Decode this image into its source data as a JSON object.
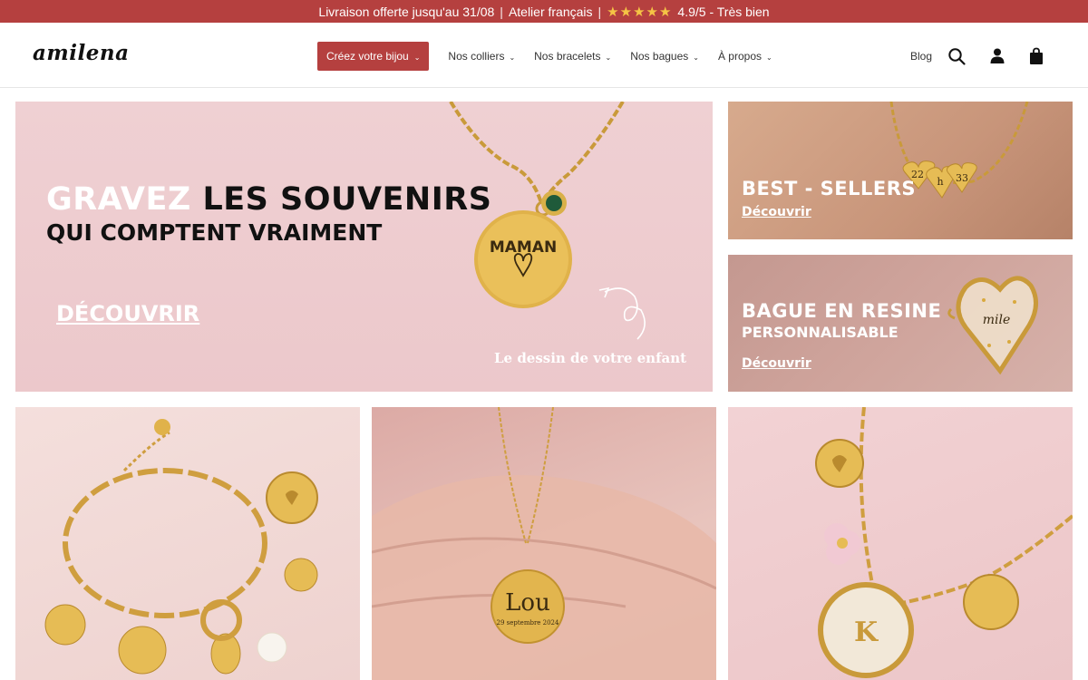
{
  "topbar": {
    "shipping": "Livraison offerte jusqu'au 31/08",
    "separator": "|",
    "atelier": "Atelier français",
    "stars": "★★★★★",
    "rating": "4.9/5 - Très bien"
  },
  "header": {
    "logo": "amilena",
    "cta": "Créez votre bijou",
    "nav": [
      "Nos colliers",
      "Nos bracelets",
      "Nos bagues",
      "À propos"
    ],
    "blog": "Blog",
    "icons": [
      "search-icon",
      "account-icon",
      "cart-icon"
    ]
  },
  "hero": {
    "title_light": "GRAVEZ",
    "title_dark": "LES SOUVENIRS",
    "subtitle": "QUI COMPTENT VRAIMENT",
    "link": "DÉCOUVRIR",
    "caption": "Le dessin de votre enfant",
    "pendant_text": "MAMAN"
  },
  "bestsellers": {
    "title": "BEST - SELLERS",
    "link": "Découvrir",
    "charms": [
      "22",
      "h",
      "33"
    ]
  },
  "resin": {
    "title": "BAGUE EN RESINE",
    "subtitle": "PERSONNALISABLE",
    "link": "Découvrir",
    "ring_text": "mile"
  },
  "products": {
    "necklace_name": "Lou",
    "necklace_date": "29 septembre 2024",
    "charm_letter": "K"
  },
  "colors": {
    "brand": "#b5403f",
    "stars": "#f5c445",
    "gold": "#d9a93e"
  }
}
